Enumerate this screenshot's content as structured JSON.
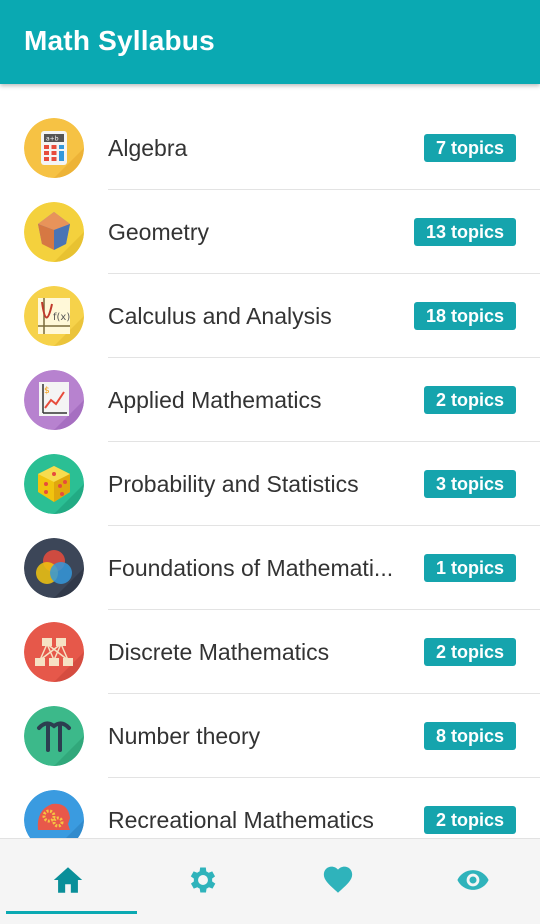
{
  "app": {
    "title": "Math Syllabus"
  },
  "colors": {
    "accent": "#0aa9b2",
    "badge": "#15a4ad"
  },
  "categories": [
    {
      "name": "Algebra",
      "topics": "7 topics",
      "icon": "calculator-icon"
    },
    {
      "name": "Geometry",
      "topics": "13 topics",
      "icon": "polyhedron-icon"
    },
    {
      "name": "Calculus and Analysis",
      "topics": "18 topics",
      "icon": "function-graph-icon"
    },
    {
      "name": "Applied Mathematics",
      "topics": "2 topics",
      "icon": "growth-chart-icon"
    },
    {
      "name": "Probability and Statistics",
      "topics": "3 topics",
      "icon": "dice-icon"
    },
    {
      "name": "Foundations of Mathemati...",
      "topics": "1 topics",
      "icon": "venn-diagram-icon"
    },
    {
      "name": "Discrete Mathematics",
      "topics": "2 topics",
      "icon": "graph-network-icon"
    },
    {
      "name": "Number theory",
      "topics": "8 topics",
      "icon": "pi-symbol-icon"
    },
    {
      "name": "Recreational Mathematics",
      "topics": "2 topics",
      "icon": "brain-gears-icon"
    }
  ],
  "bottom_nav": [
    {
      "icon": "home-icon",
      "active": true
    },
    {
      "icon": "gear-icon",
      "active": false
    },
    {
      "icon": "heart-icon",
      "active": false
    },
    {
      "icon": "eye-icon",
      "active": false
    }
  ]
}
